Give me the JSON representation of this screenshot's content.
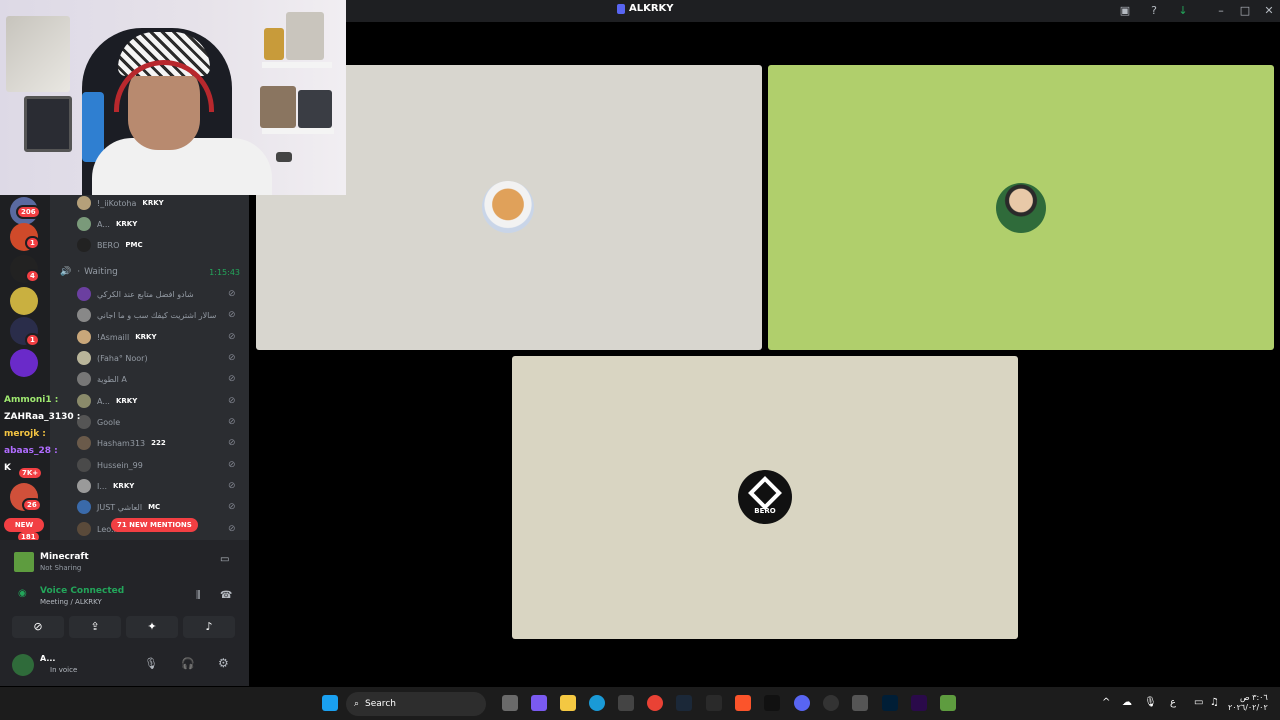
{
  "window": {
    "title": "ALKRKY"
  },
  "sidebar": {
    "badges": [
      "206",
      "1",
      "4",
      "1",
      "7K+",
      "26",
      "181"
    ],
    "new_label": "NEW",
    "chat": [
      {
        "name": "Ammoni1 :",
        "color": "#9fe870"
      },
      {
        "name": "ZAHRaa_3130 :",
        "color": "#ffffff"
      },
      {
        "name": "merojk :",
        "color": "#f4c542"
      },
      {
        "name": "abaas_28 :",
        "color": "#b06cff"
      },
      {
        "name": "K",
        "color": "#ffffff"
      }
    ]
  },
  "channel": {
    "top_users": [
      {
        "name": "!_iiKotoha",
        "tag": "KRKY",
        "color": "#b5a07a"
      },
      {
        "name": "A...",
        "tag": "KRKY",
        "color": "#7a9a7a"
      },
      {
        "name": "BERO",
        "tag": "PMC",
        "color": "#222222"
      }
    ],
    "waiting_name": "Waiting",
    "waiting_time": "1:15:43",
    "waiting_users": [
      {
        "name": "شادو افضل متابع عند الكركي",
        "tag": "",
        "color": "#6b3fa0"
      },
      {
        "name": "سالار اشتريت كيفك سب و ما اجاني",
        "tag": "",
        "color": "#888888"
      },
      {
        "name": "!Asmaill",
        "tag": "KRKY",
        "color": "#c9a77a"
      },
      {
        "name": "(Faha° Noor)",
        "tag": "",
        "color": "#b9b59a"
      },
      {
        "name": "الطوية A",
        "tag": "",
        "color": "#777777"
      },
      {
        "name": "A...",
        "tag": "KRKY",
        "color": "#8a8a6a"
      },
      {
        "name": "Goole",
        "tag": "",
        "color": "#555555"
      },
      {
        "name": "Hasham313",
        "tag": "222",
        "color": "#6a5a4a"
      },
      {
        "name": "Hussein_99",
        "tag": "",
        "color": "#4a4a4a"
      },
      {
        "name": "I...",
        "tag": "KRKY",
        "color": "#9a9a9a"
      },
      {
        "name": "JUST العاشي",
        "tag": "MC",
        "color": "#3a6aaa"
      },
      {
        "name": "Leo...",
        "tag": "",
        "color": "#5a4a3a"
      }
    ],
    "mentions_label": "71 NEW MENTIONS"
  },
  "panel": {
    "activity_title": "Minecraft",
    "activity_sub": "Not Sharing",
    "voice_status": "Voice Connected",
    "voice_channel": "Meeting / ALKRKY",
    "user_name": "A...",
    "user_status": "In voice"
  },
  "stage": {
    "tile_colors": [
      "#d8d6cf",
      "#b0cf6c",
      "#d9d5c2"
    ],
    "bero_label": "BERO"
  },
  "taskbar": {
    "search_placeholder": "Search",
    "time": "٣:٠٦ ص",
    "date": "٢٠٢٦/٠٢/٠٢",
    "lang": "ع"
  },
  "colors": {
    "discord_dark": "#1e1f22",
    "discord_mid": "#2b2d31",
    "green": "#23a55a",
    "red": "#f23f43",
    "blurple": "#5865f2"
  }
}
